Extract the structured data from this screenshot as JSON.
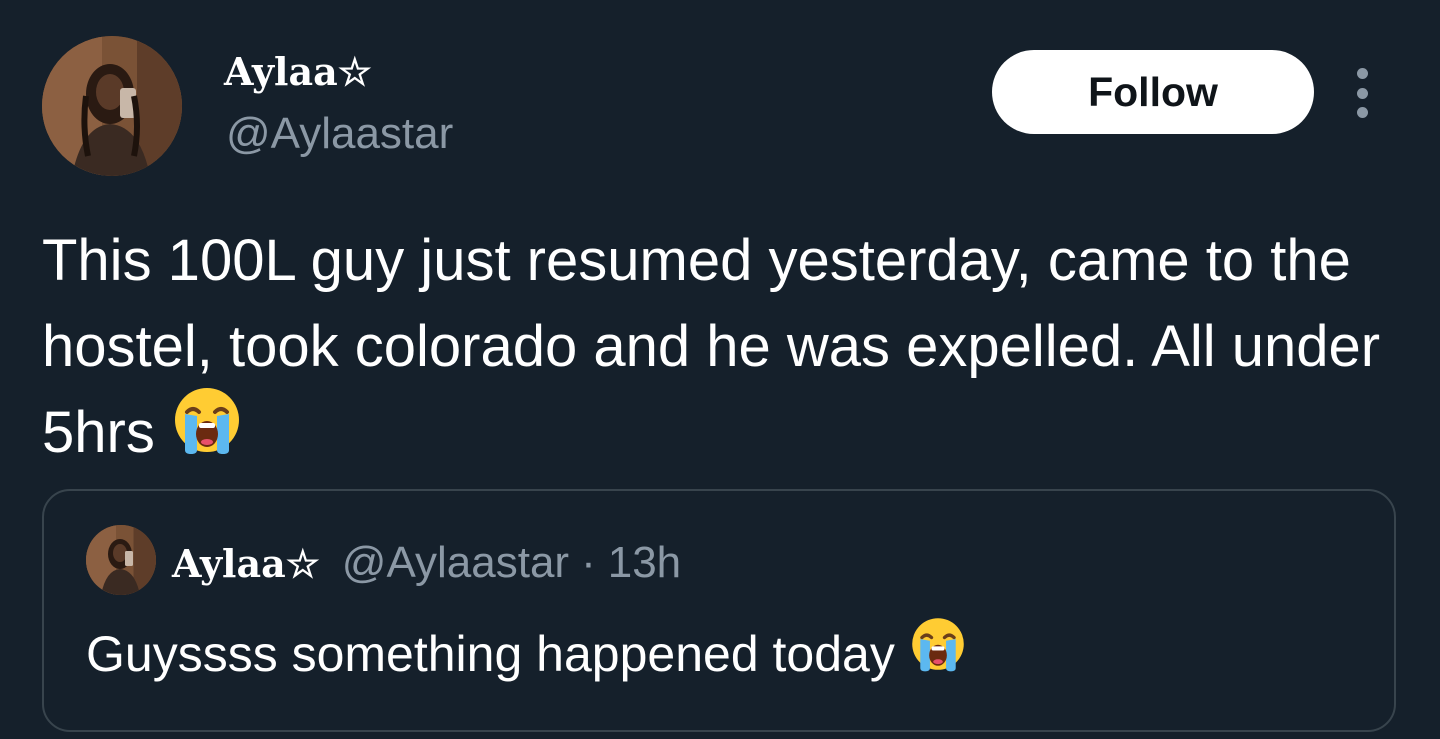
{
  "author": {
    "display_name": "Aylaa☆",
    "handle": "@Aylaastar"
  },
  "actions": {
    "follow_label": "Follow"
  },
  "tweet": {
    "text": "This 100L guy just resumed yesterday, came to the hostel, took colorado and he was expelled. All under 5hrs",
    "emoji": "loudly-crying-face-icon"
  },
  "quoted_tweet": {
    "display_name": "Aylaa☆",
    "handle": "@Aylaastar",
    "separator": "·",
    "time": "13h",
    "text": "Guyssss something happened today",
    "emoji": "loudly-crying-face-icon"
  },
  "colors": {
    "background": "#15202b",
    "text_primary": "#ffffff",
    "text_secondary": "#8b98a5",
    "border": "#38444d",
    "follow_button_bg": "#ffffff",
    "follow_button_text": "#0f1419"
  }
}
